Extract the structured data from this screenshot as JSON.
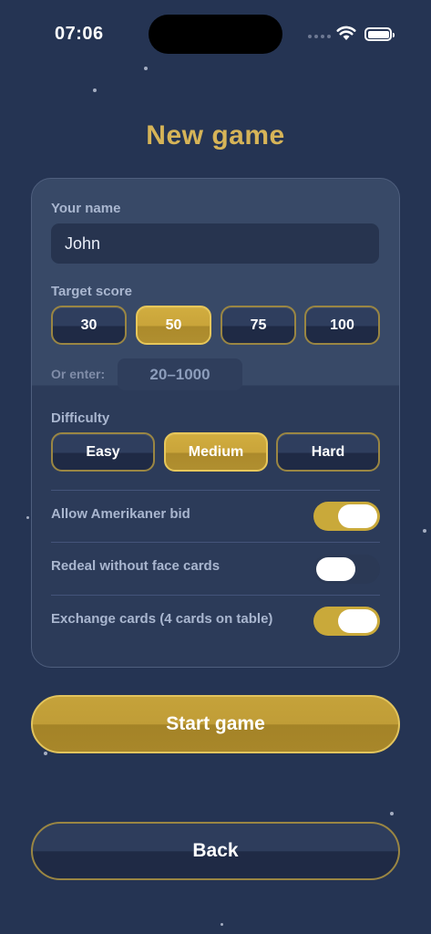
{
  "status_bar": {
    "time": "07:06"
  },
  "page": {
    "title": "New game"
  },
  "form": {
    "name_label": "Your name",
    "name_value": "John",
    "target_label": "Target score",
    "target_options": [
      "30",
      "50",
      "75",
      "100"
    ],
    "target_selected": "50",
    "or_enter_label": "Or enter:",
    "custom_placeholder": "20–1000",
    "difficulty_label": "Difficulty",
    "difficulty_options": [
      "Easy",
      "Medium",
      "Hard"
    ],
    "difficulty_selected": "Medium",
    "options": [
      {
        "label": "Allow Amerikaner bid",
        "enabled": true
      },
      {
        "label": "Redeal without face cards",
        "enabled": false
      },
      {
        "label": "Exchange cards (4 cards on table)",
        "enabled": true
      }
    ]
  },
  "actions": {
    "start_label": "Start game",
    "back_label": "Back"
  },
  "colors": {
    "background": "#253453",
    "accent_gold": "#d6b458",
    "toggle_on": "#c9a93a"
  }
}
